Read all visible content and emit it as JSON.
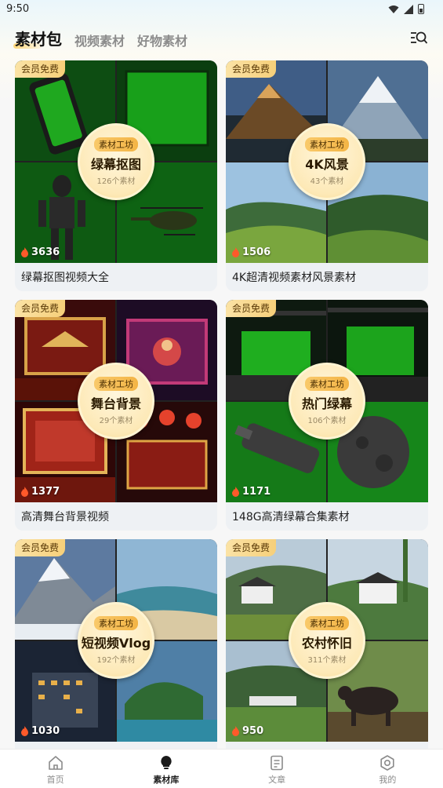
{
  "status_bar": {
    "time": "9:50"
  },
  "header": {
    "tabs": [
      {
        "label": "素材包",
        "active": true
      },
      {
        "label": "视频素材",
        "active": false
      },
      {
        "label": "好物素材",
        "active": false
      }
    ],
    "search_icon": "list-search-icon"
  },
  "cards": [
    {
      "badge": "会员免费",
      "tag": "素材工坊",
      "name": "绿幕抠图",
      "count": "126个素材",
      "hot": "3636",
      "title": "绿幕抠图视频大全",
      "theme": "greenscreen"
    },
    {
      "badge": "会员免费",
      "tag": "素材工坊",
      "name": "4K风景",
      "count": "43个素材",
      "hot": "1506",
      "title": "4K超清视频素材风景素材",
      "theme": "landscape"
    },
    {
      "badge": "会员免费",
      "tag": "素材工坊",
      "name": "舞台背景",
      "count": "29个素材",
      "hot": "1377",
      "title": "高清舞台背景视频",
      "theme": "stage"
    },
    {
      "badge": "会员免费",
      "tag": "素材工坊",
      "name": "热门绿幕",
      "count": "106个素材",
      "hot": "1171",
      "title": "148G高清绿幕合集素材",
      "theme": "greenstudio"
    },
    {
      "badge": "会员免费",
      "tag": "素材工坊",
      "name": "短视频Vlog",
      "count": "192个素材",
      "hot": "1030",
      "title": "",
      "theme": "vlog"
    },
    {
      "badge": "会员免费",
      "tag": "素材工坊",
      "name": "农村怀旧",
      "count": "311个素材",
      "hot": "950",
      "title": "",
      "theme": "village"
    }
  ],
  "bottom_nav": [
    {
      "label": "首页",
      "icon": "home-icon",
      "active": false
    },
    {
      "label": "素材库",
      "icon": "bulb-icon",
      "active": true
    },
    {
      "label": "文章",
      "icon": "document-icon",
      "active": false
    },
    {
      "label": "我的",
      "icon": "settings-icon",
      "active": false
    }
  ],
  "colors": {
    "accent": "#f6cf79",
    "hot": "#ff5a2a",
    "green": "#1f8a1f"
  }
}
